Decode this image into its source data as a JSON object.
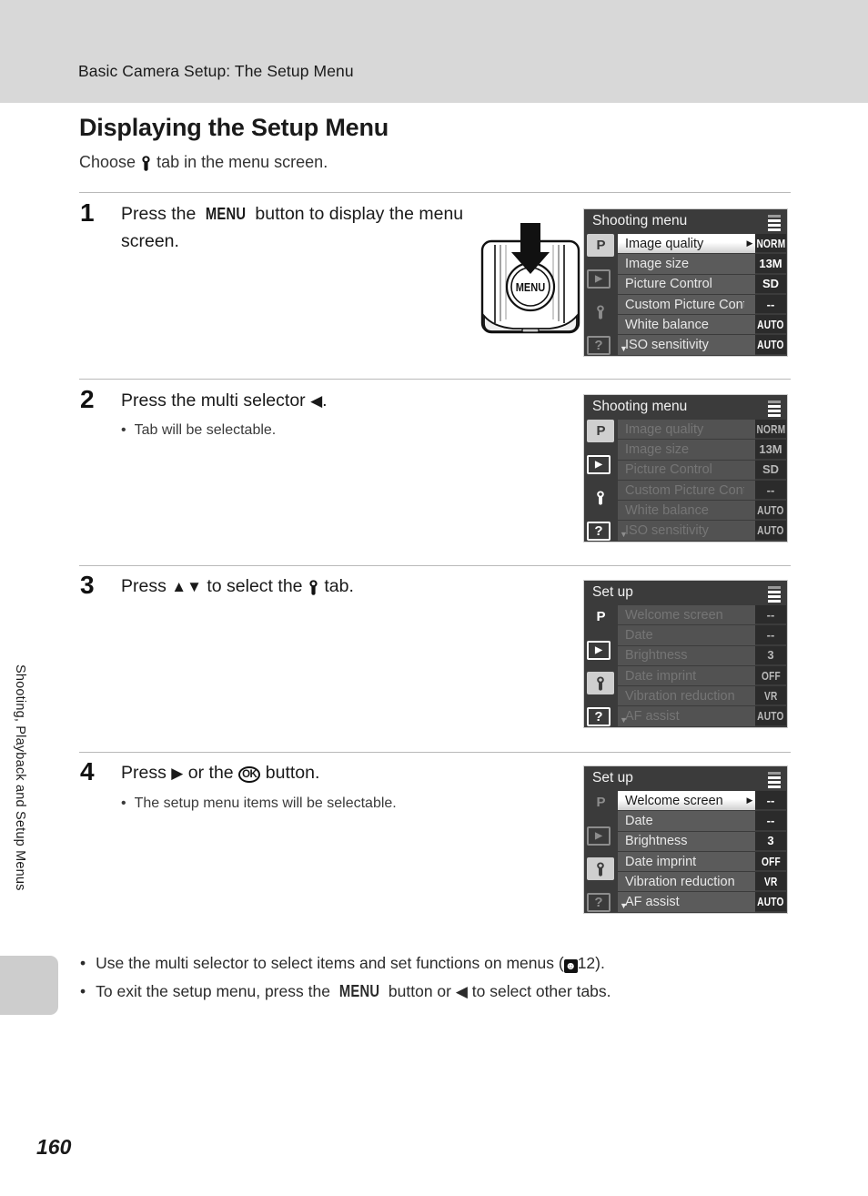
{
  "header": {
    "breadcrumb": "Basic Camera Setup: The Setup Menu"
  },
  "section": {
    "title": "Displaying the Setup Menu",
    "subtitle_before": "Choose",
    "subtitle_after": "tab in the menu screen."
  },
  "sidebar": {
    "vertical_label": "Shooting, Playback and Setup Menus"
  },
  "page_number": "160",
  "steps": [
    {
      "number": "1",
      "text_before": "Press the",
      "glyph": "MENU",
      "text_after": "button to display the menu screen.",
      "bullet": ""
    },
    {
      "number": "2",
      "text_before": "Press the multi selector",
      "glyph": "◀",
      "text_after": ".",
      "bullet": "Tab will be selectable."
    },
    {
      "number": "3",
      "text_before": "Press",
      "glyph": "▲▼",
      "text_after": "to select the",
      "glyph2": "wrench",
      "text_end": "tab.",
      "bullet": ""
    },
    {
      "number": "4",
      "text_before": "Press",
      "glyph": "▶",
      "text_after": "or the",
      "glyph2": "OK",
      "text_end": "button.",
      "bullet": "The setup menu items will be selectable."
    }
  ],
  "camera": {
    "button_label": "MENU",
    "arrow": "down-arrow"
  },
  "screens": [
    {
      "id": "shooting-menu-active",
      "title": "Shooting menu",
      "state": "active",
      "selected_tab": 0,
      "tabs": [
        "P",
        "playback",
        "wrench",
        "help"
      ],
      "rows": [
        {
          "label": "Image quality",
          "value": "NORM",
          "highlighted": true
        },
        {
          "label": "Image size",
          "value": "13M",
          "highlighted": false
        },
        {
          "label": "Picture Control",
          "value": "SD",
          "highlighted": false
        },
        {
          "label": "Custom Picture Control",
          "value": "--",
          "highlighted": false
        },
        {
          "label": "White balance",
          "value": "AUTO",
          "highlighted": false
        },
        {
          "label": "ISO sensitivity",
          "value": "AUTO",
          "highlighted": false
        }
      ]
    },
    {
      "id": "shooting-menu-dimmed",
      "title": "Shooting menu",
      "state": "dimmed",
      "selected_tab": 0,
      "tabs": [
        "P",
        "playback",
        "wrench",
        "help"
      ],
      "rows": [
        {
          "label": "Image quality",
          "value": "NORM",
          "highlighted": false
        },
        {
          "label": "Image size",
          "value": "13M",
          "highlighted": false
        },
        {
          "label": "Picture Control",
          "value": "SD",
          "highlighted": false
        },
        {
          "label": "Custom Picture Control",
          "value": "--",
          "highlighted": false
        },
        {
          "label": "White balance",
          "value": "AUTO",
          "highlighted": false
        },
        {
          "label": "ISO sensitivity",
          "value": "AUTO",
          "highlighted": false
        }
      ]
    },
    {
      "id": "setup-menu-dimmed",
      "title": "Set up",
      "state": "dimmed",
      "selected_tab": 2,
      "tabs": [
        "P",
        "playback",
        "wrench",
        "help"
      ],
      "rows": [
        {
          "label": "Welcome screen",
          "value": "--",
          "highlighted": false
        },
        {
          "label": "Date",
          "value": "--",
          "highlighted": false
        },
        {
          "label": "Brightness",
          "value": "3",
          "highlighted": false
        },
        {
          "label": "Date imprint",
          "value": "OFF",
          "highlighted": false
        },
        {
          "label": "Vibration reduction",
          "value": "VR",
          "highlighted": false
        },
        {
          "label": "AF assist",
          "value": "AUTO",
          "highlighted": false
        }
      ]
    },
    {
      "id": "setup-menu-active",
      "title": "Set up",
      "state": "active",
      "selected_tab": 2,
      "tabs": [
        "P",
        "playback",
        "wrench",
        "help"
      ],
      "rows": [
        {
          "label": "Welcome screen",
          "value": "--",
          "highlighted": true
        },
        {
          "label": "Date",
          "value": "--",
          "highlighted": false
        },
        {
          "label": "Brightness",
          "value": "3",
          "highlighted": false
        },
        {
          "label": "Date imprint",
          "value": "OFF",
          "highlighted": false
        },
        {
          "label": "Vibration reduction",
          "value": "VR",
          "highlighted": false
        },
        {
          "label": "AF assist",
          "value": "AUTO",
          "highlighted": false
        }
      ]
    }
  ],
  "footer_bullets": [
    {
      "text_before": "Use the multi selector to select items and set functions on menus (",
      "ref_icon": "book-icon",
      "ref_page": "12",
      "text_after": ")."
    },
    {
      "text_before": "To exit the setup menu, press the",
      "glyph": "MENU",
      "text_mid": "button or",
      "glyph2": "◀",
      "text_after": "to select other tabs."
    }
  ]
}
